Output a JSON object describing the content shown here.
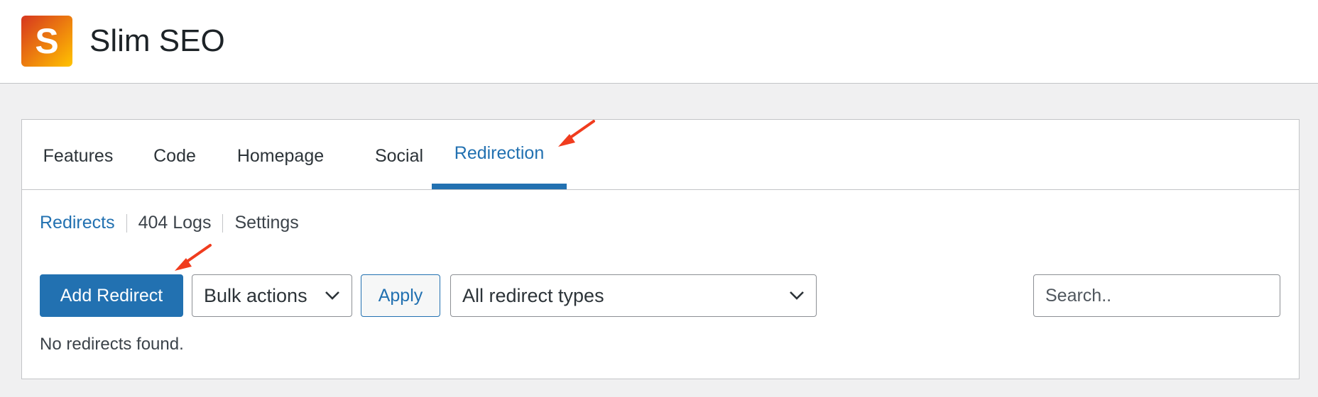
{
  "app": {
    "title": "Slim SEO",
    "logo_letter": "S"
  },
  "tabs": [
    {
      "label": "Features",
      "active": false
    },
    {
      "label": "Code",
      "active": false
    },
    {
      "label": "Homepage",
      "active": false
    },
    {
      "label": "Social",
      "active": false
    },
    {
      "label": "Redirection",
      "active": true
    }
  ],
  "subnav": {
    "items": [
      {
        "label": "Redirects",
        "current": true
      },
      {
        "label": "404 Logs",
        "current": false
      },
      {
        "label": "Settings",
        "current": false
      }
    ]
  },
  "toolbar": {
    "add_label": "Add Redirect",
    "bulk_actions": "Bulk actions",
    "apply_label": "Apply",
    "type_filter": "All redirect types",
    "search_placeholder": "Search.."
  },
  "empty_message": "No redirects found.",
  "colors": {
    "accent": "#2271b1",
    "annotation_arrow": "#f03c1e"
  },
  "icons": {
    "dropdown": "chevron-down-icon",
    "annotation": "arrow-icon"
  }
}
